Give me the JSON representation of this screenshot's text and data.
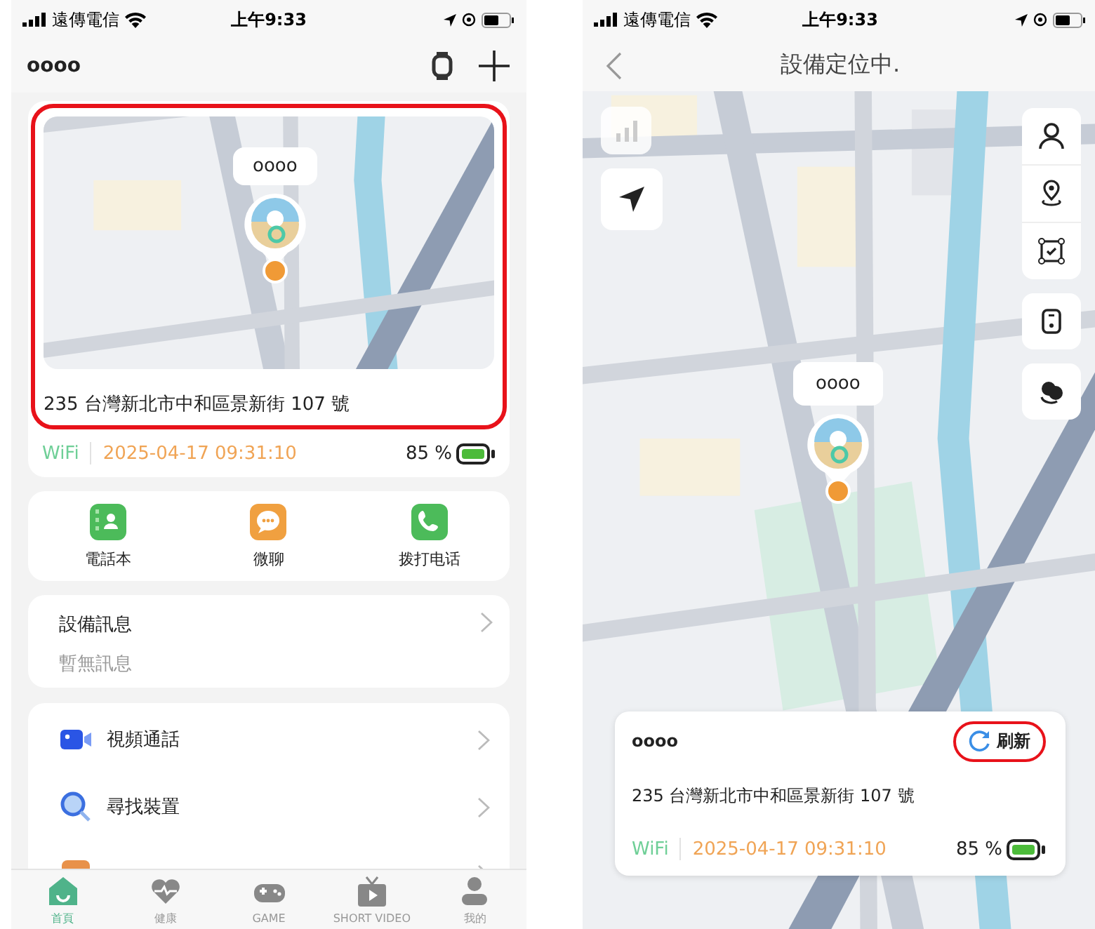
{
  "home_screen": {
    "status_bar": {
      "carrier": "遠傳電信",
      "time": "上午9:33"
    },
    "header": {
      "title": "oooo"
    },
    "location_card": {
      "highlighted": true,
      "marker_label": "oooo",
      "address": "235 台灣新北市中和區景新街 107 號",
      "network": "WiFi",
      "timestamp": "2025-04-17 09:31:10",
      "battery": "85 %"
    },
    "quick_actions": [
      {
        "label": "電話本",
        "kind": "contacts"
      },
      {
        "label": "微聊",
        "kind": "chat"
      },
      {
        "label": "拨打电话",
        "kind": "phone"
      }
    ],
    "device_info": {
      "title": "設備訊息",
      "subtitle": "暫無訊息"
    },
    "menu": [
      {
        "label": "視頻通話",
        "kind": "video"
      },
      {
        "label": "尋找裝置",
        "kind": "search"
      },
      {
        "kind": "app"
      }
    ],
    "tab_bar": [
      {
        "label": "首頁",
        "kind": "home",
        "selected": true
      },
      {
        "label": "健康",
        "kind": "health",
        "selected": false
      },
      {
        "label": "GAME",
        "kind": "game",
        "selected": false
      },
      {
        "label": "SHORT VIDEO",
        "kind": "tv",
        "selected": false
      },
      {
        "label": "我的",
        "kind": "profile",
        "selected": false
      }
    ]
  },
  "locate_screen": {
    "status_bar": {
      "carrier": "遠傳電信",
      "time": "上午9:33"
    },
    "header": {
      "title": "設備定位中."
    },
    "marker_label": "oooo",
    "info_card": {
      "name": "oooo",
      "refresh": "刷新",
      "refresh_highlighted": true,
      "address": "235 台灣新北市中和區景新街 107 號",
      "network": "WiFi",
      "timestamp": "2025-04-17 09:31:10",
      "battery": "85 %"
    }
  }
}
